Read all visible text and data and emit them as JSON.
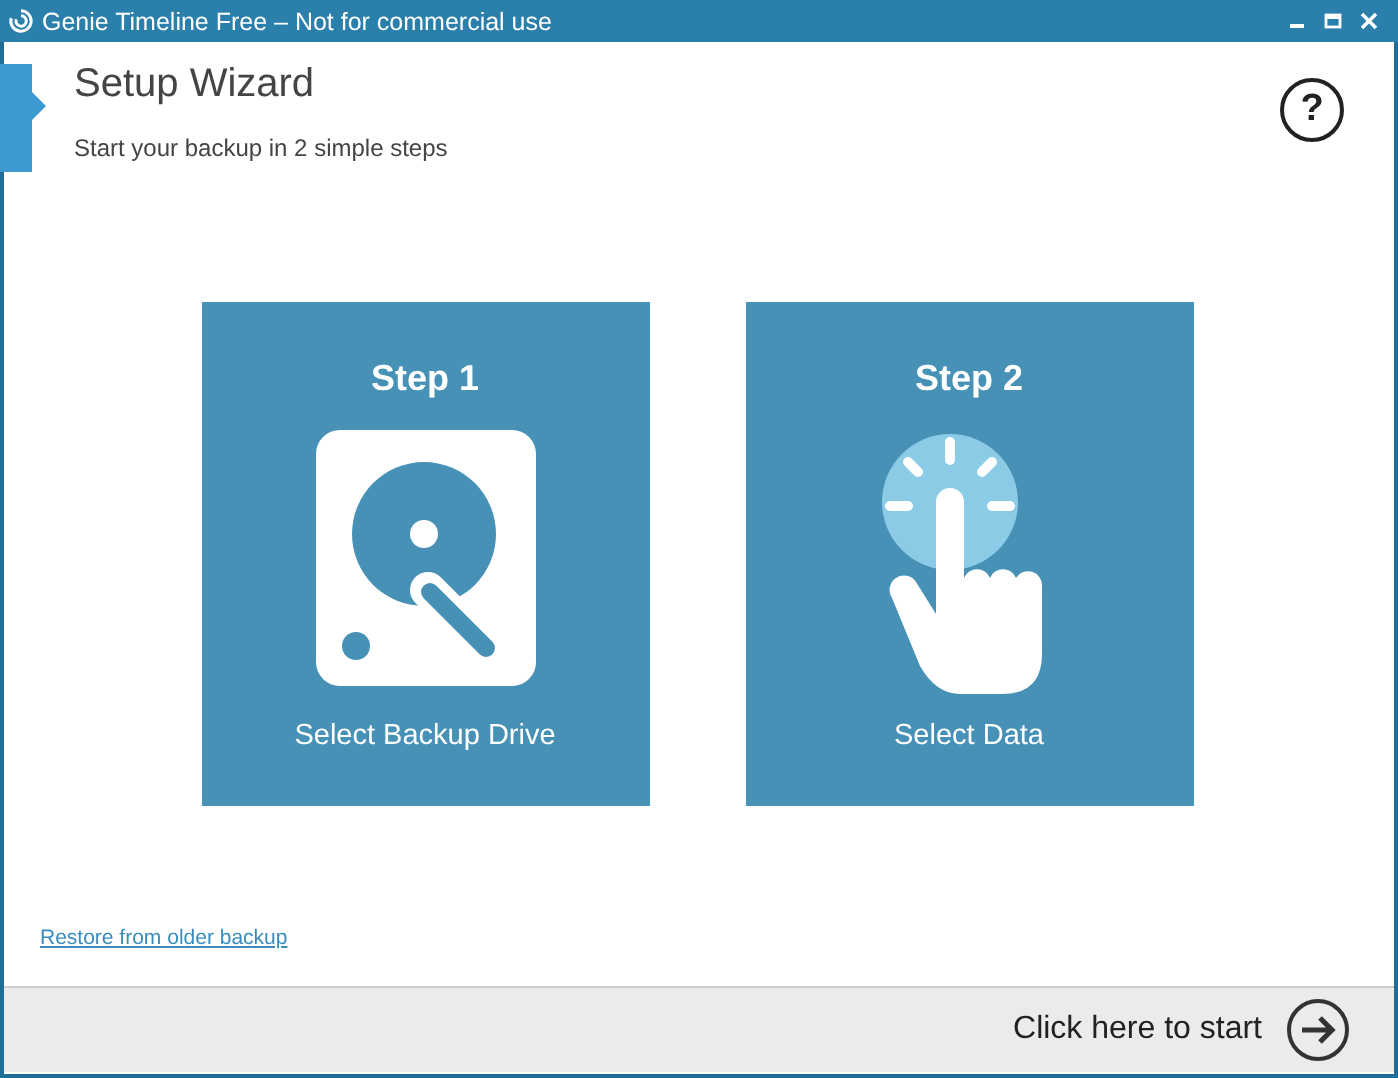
{
  "window": {
    "title": "Genie Timeline Free – Not for commercial use"
  },
  "header": {
    "title": "Setup Wizard",
    "subtitle": "Start your backup in 2 simple steps",
    "help": "?"
  },
  "steps": [
    {
      "kind": "drive",
      "title": "Step 1",
      "label": "Select Backup Drive"
    },
    {
      "kind": "touch",
      "title": "Step 2",
      "label": "Select Data"
    }
  ],
  "restore_link": "Restore from older backup",
  "footer": {
    "start": "Click here to start"
  }
}
